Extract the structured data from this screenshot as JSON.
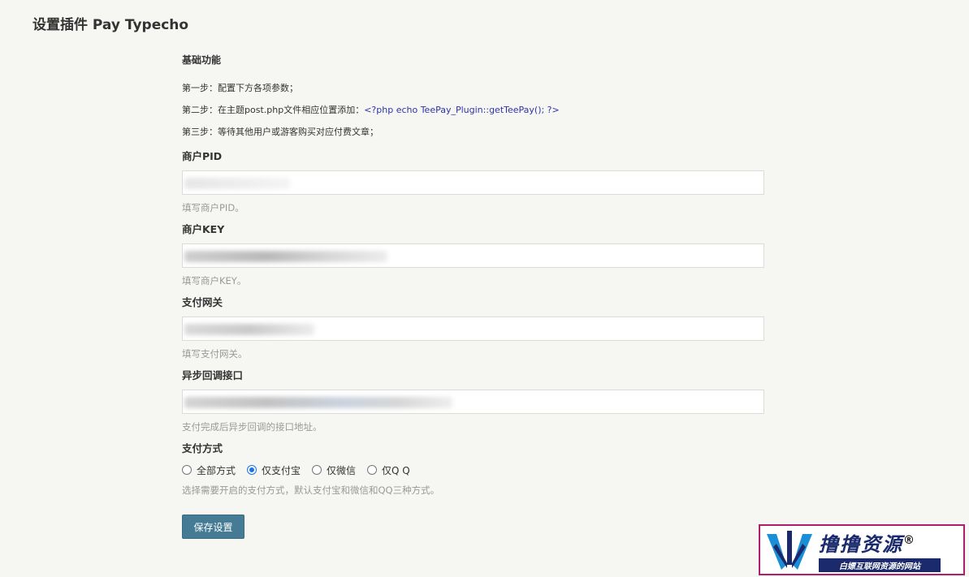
{
  "page": {
    "title": "设置插件 Pay Typecho"
  },
  "basic": {
    "title": "基础功能",
    "steps": [
      "第一步：配置下方各项参数；",
      "第二步：在主题post.php文件相应位置添加：",
      "第三步：等待其他用户或游客购买对应付费文章；"
    ],
    "code_snippet": "<?php echo TeePay_Plugin::getTeePay(); ?>"
  },
  "fields": [
    {
      "label": "商户PID",
      "hint": "填写商户PID。"
    },
    {
      "label": "商户KEY",
      "hint": "填写商户KEY。"
    },
    {
      "label": "支付网关",
      "hint": "填写支付网关。"
    },
    {
      "label": "异步回调接口",
      "hint": "支付完成后异步回调的接口地址。"
    }
  ],
  "payment": {
    "label": "支付方式",
    "options": [
      "全部方式",
      "仅支付宝",
      "仅微信",
      "仅Q Q"
    ],
    "selected": "仅支付宝",
    "hint": "选择需要开启的支付方式，默认支付宝和微信和QQ三种方式。"
  },
  "actions": {
    "save_label": "保存设置"
  },
  "watermark": {
    "title": "撸撸资源",
    "registered": "®",
    "subtitle": "白嫖互联网资源的网站"
  },
  "colors": {
    "primary_button": "#467b96",
    "code_text": "#2d34a8",
    "radio_checked": "#1a73e8",
    "watermark_border": "#b01d6e"
  }
}
